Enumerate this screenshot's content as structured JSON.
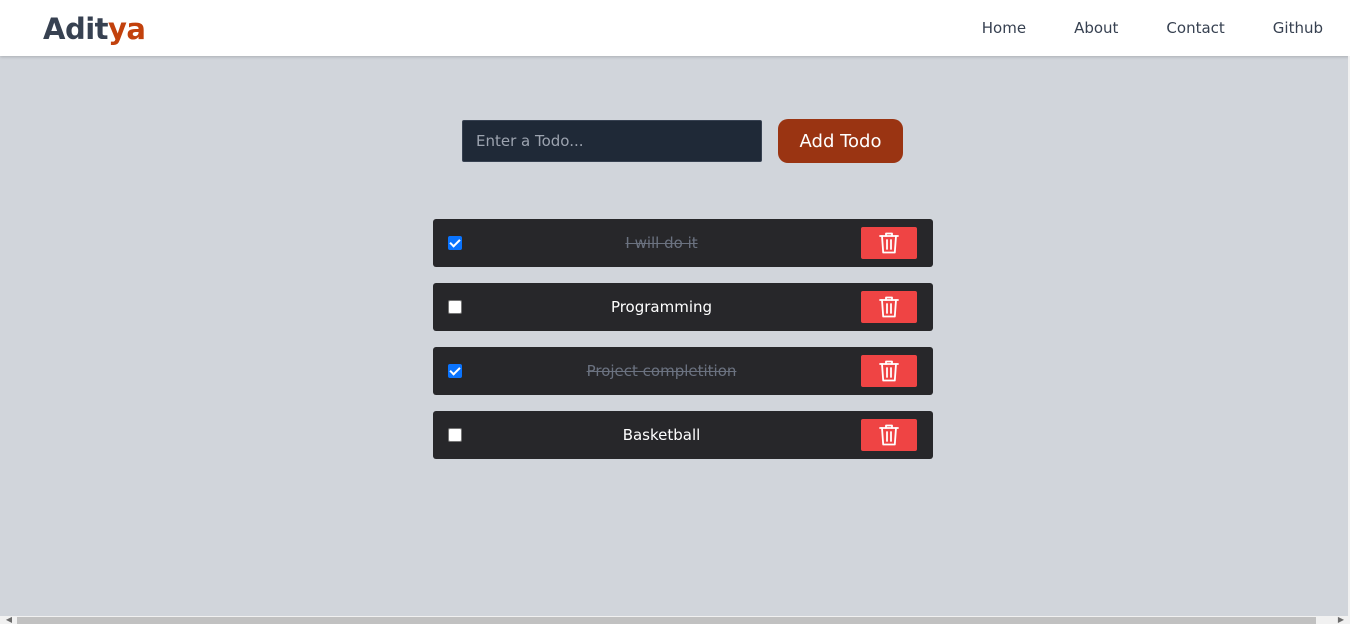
{
  "brand": {
    "part1": "Adit",
    "part2": "ya"
  },
  "nav": {
    "links": [
      {
        "label": "Home"
      },
      {
        "label": "About"
      },
      {
        "label": "Contact"
      },
      {
        "label": "Github"
      }
    ]
  },
  "input": {
    "placeholder": "Enter a Todo...",
    "value": ""
  },
  "add_button": {
    "label": "Add Todo"
  },
  "todos": [
    {
      "text": "I will do it",
      "completed": true
    },
    {
      "text": "Programming",
      "completed": false
    },
    {
      "text": "Project completition",
      "completed": true
    },
    {
      "text": "Basketball",
      "completed": false
    }
  ],
  "icons": {
    "delete": "trash-icon",
    "scroll_left": "chevron-left-icon",
    "scroll_right": "chevron-right-icon"
  },
  "colors": {
    "page_bg": "#d1d5db",
    "brand_text": "#374151",
    "brand_accent": "#c2410c",
    "input_bg": "#1f2937",
    "add_button": "#9a3412",
    "todo_bg": "#27272a",
    "delete_button": "#ef4444",
    "checkbox_checked": "#0a74ff"
  }
}
